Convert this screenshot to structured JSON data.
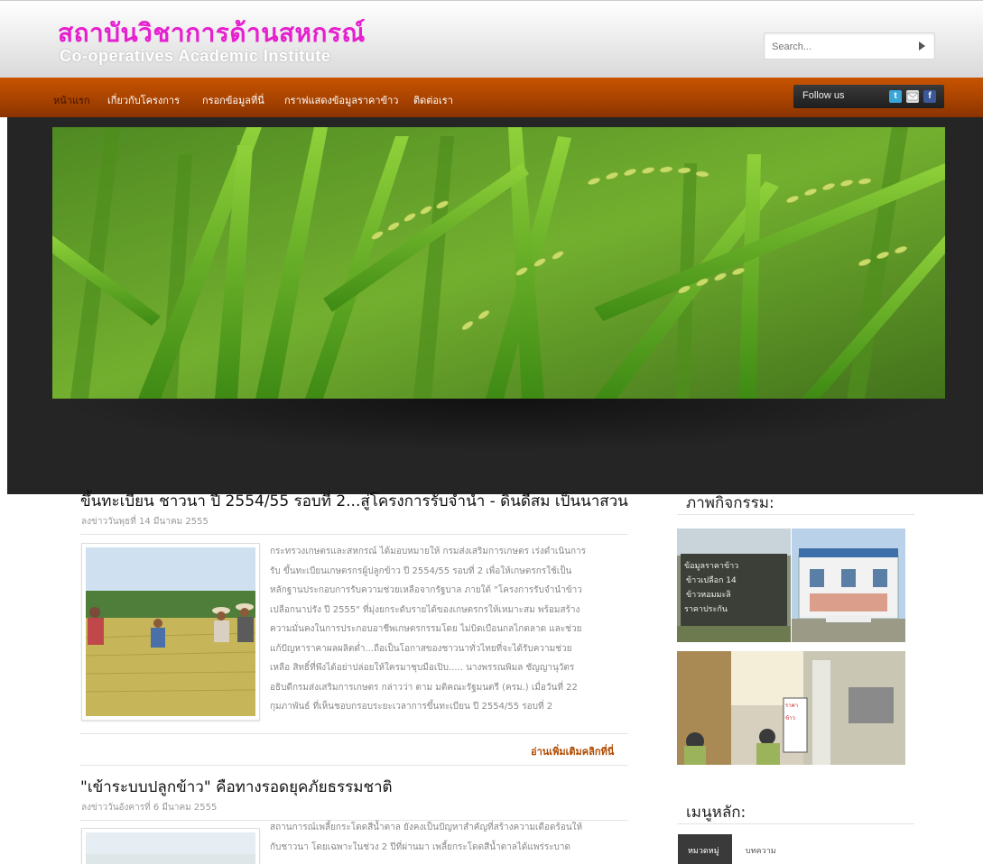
{
  "header": {
    "logo_th": "สถาบันวิชาการด้านสหกรณ์",
    "logo_en": "Co-operatives Academic Institute",
    "search_placeholder": "Search..."
  },
  "nav": {
    "items": [
      {
        "label": "หน้าแรก"
      },
      {
        "label": "เกี่ยวกับโครงการ"
      },
      {
        "label": "กรอกข้อมูลที่นี่"
      },
      {
        "label": "กราฟแสดงข้อมูลราคาข้าว"
      },
      {
        "label": "ติดต่อเรา"
      }
    ],
    "follow_label": "Follow us",
    "social": [
      {
        "icon": "twitter-icon",
        "glyph": "t",
        "color": "#3aa6d8"
      },
      {
        "icon": "email-icon",
        "glyph": "",
        "color": "#dcdcdc"
      },
      {
        "icon": "facebook-icon",
        "glyph": "f",
        "color": "#3b5998"
      }
    ]
  },
  "posts": [
    {
      "title": "ขึ้นทะเบียน ชาวนา ปี 2554/55 รอบที่ 2...สู่โครงการรับจำนำ - ดินดีสม เป็นนาสวน",
      "date": "ลงข่าววันพุธที่ 14 มีนาคม 2555",
      "body": [
        "กระทรวงเกษตรและสหกรณ์ ได้มอบหมายให้ กรมส่งเสริมการเกษตร เร่งดำเนินการ",
        "รับ ขึ้นทะเบียนเกษตรกรผู้ปลูกข้าว ปี 2554/55 รอบที่ 2 เพื่อให้เกษตรกรใช้เป็น",
        "หลักฐานประกอบการรับความช่วยเหลือจากรัฐบาล ภายใต้ \"โครงการรับจำนำข้าว",
        "เปลือกนาปรัง ปี 2555\" ที่มุ่งยกระดับรายได้ของเกษตรกรให้เหมาะสม พร้อมสร้าง",
        "ความมั่นคงในการประกอบอาชีพเกษตรกรรมโดย ไม่บิดเบือนกลไกตลาด และช่วย",
        "แก้ปัญหาราคาผลผลิตต่ำ...ถือเป็นโอกาสของชาวนาทั่วไทยที่จะได้รับความช่วย",
        "เหลือ สิทธิ์ที่พึงได้อย่าปล่อยให้ใครมาชุบมือเปิบ..... นางพรรณพิมล ชัญญานุวัตร",
        "อธิบดีกรมส่งเสริมการเกษตร กล่าวว่า ตาม มติคณะรัฐมนตรี (ครม.) เมื่อวันที่ 22",
        "กุมภาพันธ์ ที่เห็นชอบกรอบระยะเวลาการขึ้นทะเบียน ปี 2554/55 รอบที่ 2"
      ],
      "read_more": "อ่านเพิ่มเติมคลิกที่นี่"
    },
    {
      "title": "\"เข้าระบบปลูกข้าว\" คือทางรอดยุคภัยธรรมชาติ",
      "date": "ลงข่าววันอังคารที่ 6 มีนาคม 2555",
      "body": [
        "สถานการณ์เพลี้ยกระโดดสีน้ำตาล ยังคงเป็นปัญหาสำคัญที่สร้างความเดือดร้อนให้",
        "กับชาวนา โดยเฉพาะในช่วง 2 ปีที่ผ่านมา เพลี้ยกระโดดสีน้ำตาลได้แพร่ระบาด"
      ]
    }
  ],
  "sidebar": {
    "activities_title": "ภาพกิจกรรม:",
    "menu_title": "เมนูหลัก:",
    "tabs": [
      {
        "label": "หมวดหมู่"
      },
      {
        "label": "บทความ"
      }
    ]
  },
  "colors": {
    "logo_pink": "#e61fcf",
    "nav_orange": "#a84300",
    "read_more": "#b04a00"
  }
}
